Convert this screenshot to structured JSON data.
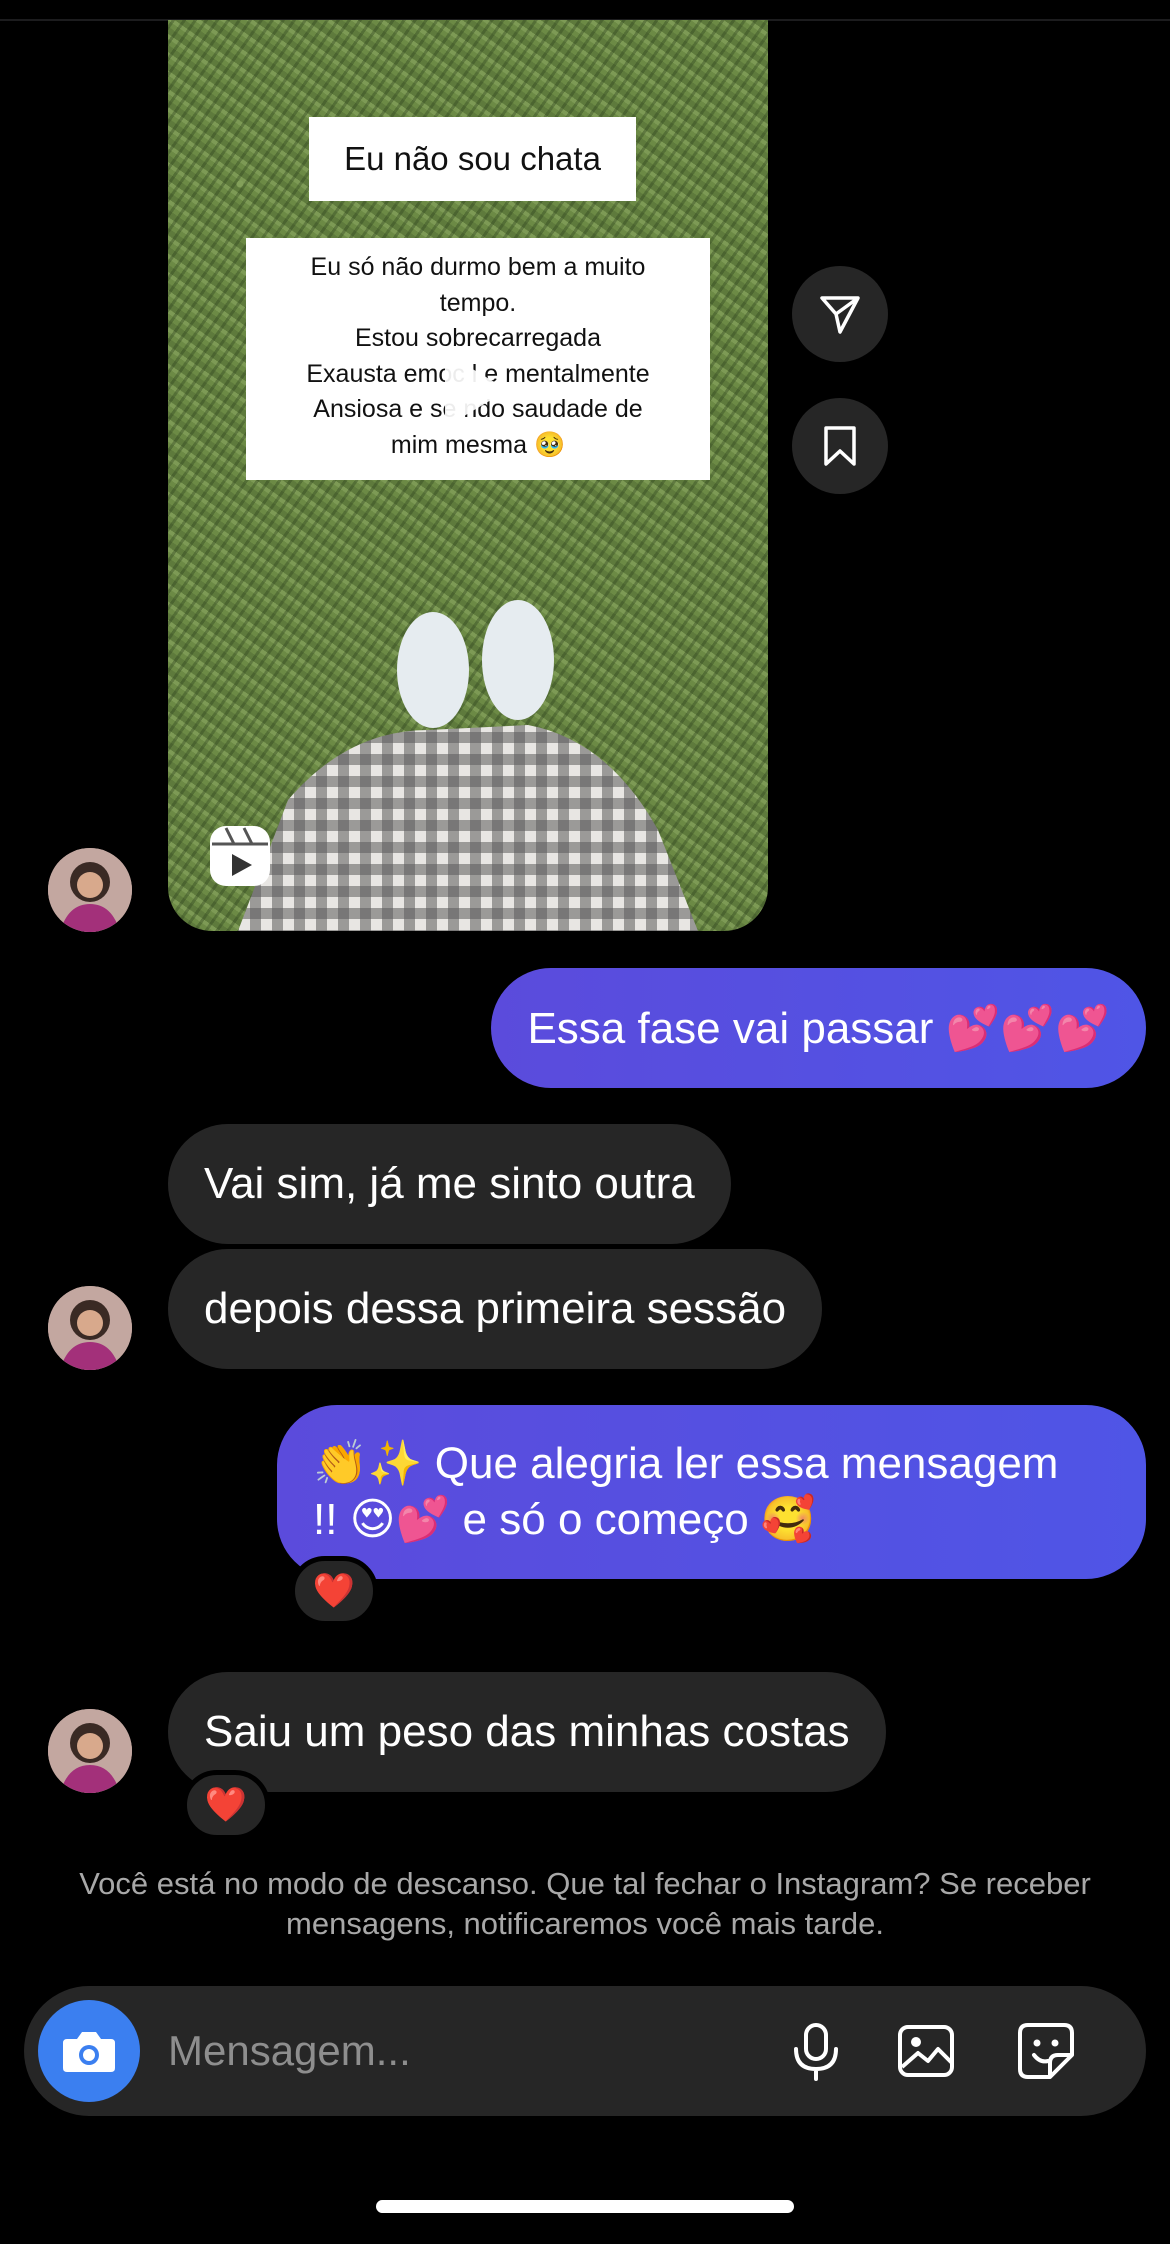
{
  "reel": {
    "title": "Eu não sou chata",
    "body": "Eu só não durmo bem a muito\ntempo.\nEstou sobrecarregada\nExausta emoc     l e mentalmente\nAnsiosa e se     ndo saudade de\nmim mesma 🥹"
  },
  "messages": [
    {
      "text": "Essa fase vai passar 💕💕💕"
    },
    {
      "text": "Vai sim, já me sinto outra"
    },
    {
      "text": "depois dessa primeira sessão"
    },
    {
      "line1": "👏✨ Que alegria ler essa mensagem",
      "line2": "!! 😍💕 e só o começo 🥰",
      "reaction": "❤️"
    },
    {
      "text": "Saiu um peso das minhas costas",
      "reaction": "❤️"
    }
  ],
  "rest_notice": "Você está no modo de descanso. Que tal fechar o Instagram? Se receber mensagens, notificaremos você mais tarde.",
  "composer": {
    "placeholder": "Mensagem...",
    "icons": [
      "camera-icon",
      "microphone-icon",
      "gallery-icon",
      "sticker-icon"
    ]
  },
  "colors": {
    "background": "#000000",
    "incoming_bubble": "#262626",
    "outgoing_bubble": "#5b4bdc",
    "camera_button": "#3b7ff0",
    "notice_text": "#a8a8a8"
  }
}
